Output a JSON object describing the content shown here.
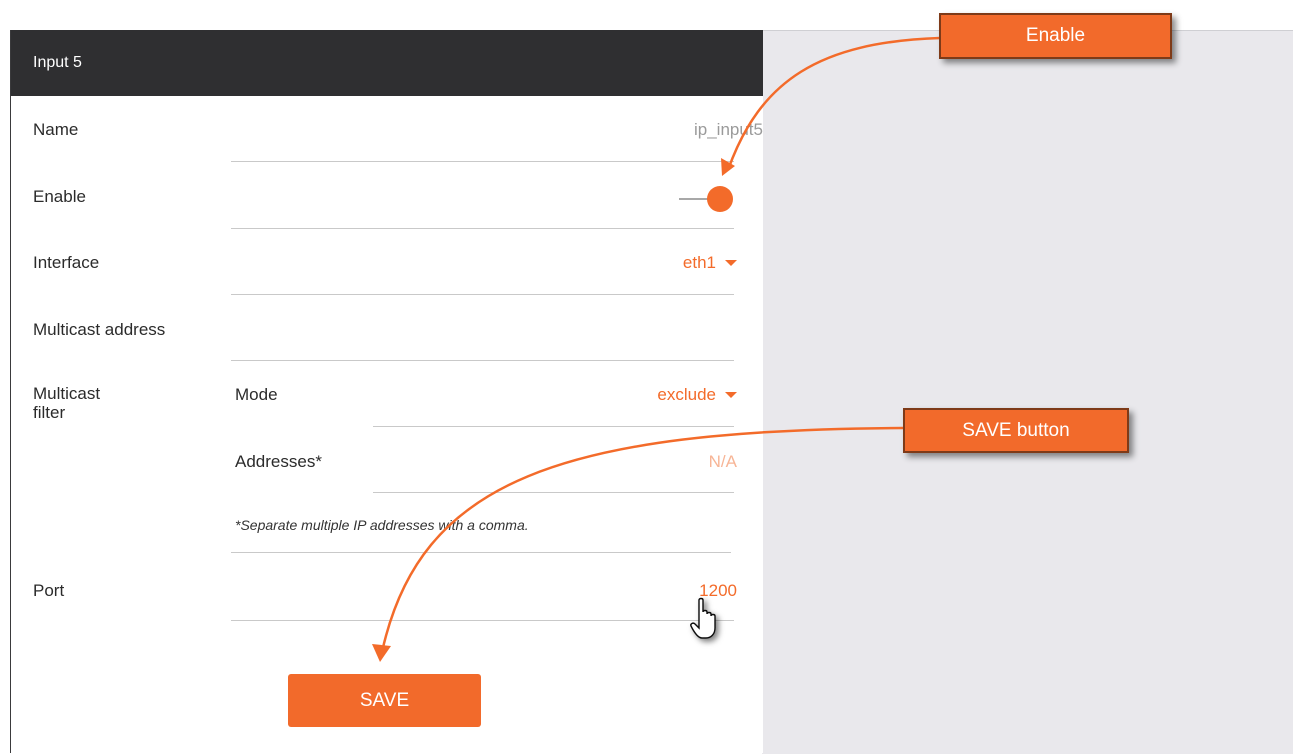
{
  "panel": {
    "title": "Input 5",
    "rows": {
      "name": {
        "label": "Name",
        "value": "ip_input5"
      },
      "enable": {
        "label": "Enable",
        "enabled": true
      },
      "interface": {
        "label": "Interface",
        "value": "eth1"
      },
      "multicast_address": {
        "label": "Multicast address",
        "value": ""
      },
      "multicast_filter": {
        "label_line1": "Multicast",
        "label_line2": "filter",
        "mode": {
          "label": "Mode",
          "value": "exclude"
        },
        "addresses": {
          "label": "Addresses*",
          "value": "N/A"
        },
        "note": "*Separate multiple IP addresses with a comma."
      },
      "port": {
        "label": "Port",
        "value": "1200"
      }
    },
    "save_label": "SAVE"
  },
  "callouts": {
    "enable": "Enable",
    "save": "SAVE button"
  },
  "colors": {
    "accent": "#f36b2a",
    "header_bg": "#2f2f31",
    "right_bg": "#e9e8ec"
  },
  "icons": [
    "chevron-down-icon",
    "hand-pointer-icon"
  ]
}
